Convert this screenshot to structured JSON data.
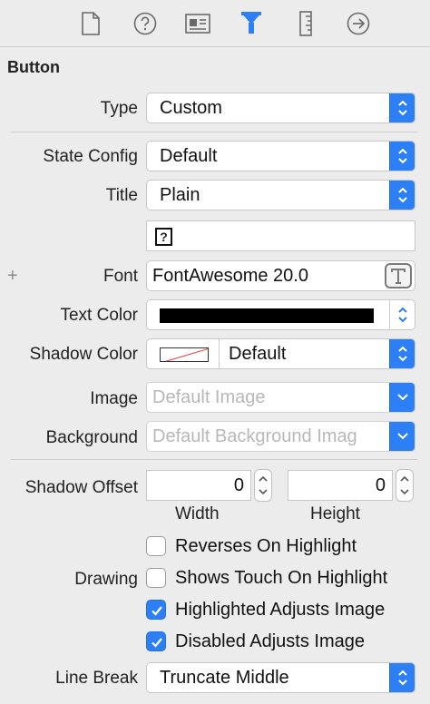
{
  "toolbar": {
    "icons": [
      "file-icon",
      "help-icon",
      "identity-icon",
      "attributes-icon",
      "size-icon",
      "connections-icon"
    ]
  },
  "section": {
    "title": "Button"
  },
  "type": {
    "label": "Type",
    "value": "Custom"
  },
  "state_config": {
    "label": "State Config",
    "value": "Default"
  },
  "title": {
    "label": "Title",
    "value": "Plain"
  },
  "font": {
    "plus": "+",
    "label": "Font",
    "value": "FontAwesome 20.0"
  },
  "text_color": {
    "label": "Text Color",
    "swatch": "#000000"
  },
  "shadow_color": {
    "label": "Shadow Color",
    "value": "Default"
  },
  "image": {
    "label": "Image",
    "placeholder": "Default Image"
  },
  "background": {
    "label": "Background",
    "placeholder": "Default Background Imag"
  },
  "shadow_offset": {
    "label": "Shadow Offset",
    "width_value": "0",
    "height_value": "0",
    "width_label": "Width",
    "height_label": "Height"
  },
  "drawing": {
    "label": "Drawing",
    "options": [
      {
        "label": "Reverses On Highlight",
        "checked": false
      },
      {
        "label": "Shows Touch On Highlight",
        "checked": false
      },
      {
        "label": "Highlighted Adjusts Image",
        "checked": true
      },
      {
        "label": "Disabled Adjusts Image",
        "checked": true
      }
    ]
  },
  "line_break": {
    "label": "Line Break",
    "value": "Truncate Middle"
  },
  "colors": {
    "accent": "#2d7ff6",
    "disabled_text": "#b8b8b8"
  }
}
